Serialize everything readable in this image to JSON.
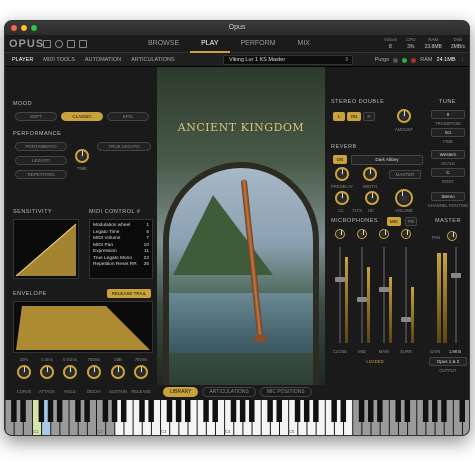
{
  "window": {
    "title": "Opus"
  },
  "app": {
    "logo": "OPUS"
  },
  "nav": {
    "tabs": [
      "BROWSE",
      "PLAY",
      "PERFORM",
      "MIX"
    ],
    "active": "PLAY"
  },
  "stats": [
    {
      "label": "Voices",
      "value": "8"
    },
    {
      "label": "CPU",
      "value": "3%"
    },
    {
      "label": "RAM",
      "value": "23.8MB"
    },
    {
      "label": "Disk",
      "value": "3MB/s"
    }
  ],
  "subnav": {
    "tabs": [
      "PLAYER",
      "MIDI TOOLS",
      "AUTOMATION",
      "ARTICULATIONS"
    ],
    "active": "PLAYER"
  },
  "preset": {
    "name": "Viking Lur 1 KS Master"
  },
  "purge": {
    "label": "Purge",
    "ram_label": "RAM",
    "ram_value": "24.1MB"
  },
  "mood": {
    "title": "MOOD",
    "buttons": [
      "SOFT",
      "CLASSIC",
      "EPIC"
    ],
    "active": "CLASSIC"
  },
  "performance": {
    "title": "PERFORMANCE",
    "buttons": [
      "PORTAMENTO",
      "TRUE LEGATO",
      "LEGATO",
      "REPETITION"
    ],
    "knob": "TIME"
  },
  "sensitivity": {
    "title": "SENSITIVITY"
  },
  "midi_control": {
    "title": "MIDI CONTROL #",
    "rows": [
      {
        "name": "Modulation wheel",
        "cc": "1"
      },
      {
        "name": "Legato Time",
        "cc": "5"
      },
      {
        "name": "MIDI Volume",
        "cc": "7"
      },
      {
        "name": "MIDI Pan",
        "cc": "10"
      },
      {
        "name": "Expression",
        "cc": "11"
      },
      {
        "name": "True Legato Mono",
        "cc": "22"
      },
      {
        "name": "Repetition Reset RR",
        "cc": "36"
      }
    ]
  },
  "envelope": {
    "title": "ENVELOPE",
    "release_btn": "RELEASE TRAIL",
    "values": [
      "20%",
      "0.3ms",
      "0.01ms",
      "750ms",
      "0dB",
      "750ms"
    ],
    "knobs": [
      "CURVE",
      "ATTACK",
      "HOLD",
      "DECAY",
      "SUSTAIN",
      "RELEASE"
    ]
  },
  "art": {
    "title": "ANCIENT KINGDOM"
  },
  "artbar": {
    "buttons": [
      "LIBRARY",
      "ARTICULATIONS",
      "MIC POSITIONS"
    ],
    "active": "LIBRARY"
  },
  "stereo": {
    "title": "STEREO DOUBLE",
    "buttons": [
      "L",
      "ON",
      "R"
    ],
    "knob": "AMOUNT"
  },
  "tune": {
    "title": "TUNE",
    "value": "0",
    "transpose": "TRANSPOSE",
    "transpose_val": "0ct",
    "fine": "FINE",
    "scale_val": "Western",
    "scale": "SCALE",
    "root_val": "C",
    "root": "ROOT"
  },
  "reverb": {
    "title": "REVERB",
    "on": "ON",
    "preset": "Dark Abbey",
    "master": "MASTER",
    "knobs": [
      "PREDELAY",
      "WIDTH",
      "LC",
      "TLTS",
      "HC",
      "VOLUME"
    ]
  },
  "channel": {
    "value": "Stereo",
    "label": "CHANNEL ROUTING"
  },
  "mics": {
    "title": "MICROPHONES",
    "btns": [
      "MIC",
      "PB"
    ],
    "channels": [
      "CLOSE",
      "MID",
      "MAIN",
      "SURR"
    ],
    "loaded": "LOADED"
  },
  "master": {
    "title": "MASTER",
    "pan": "PAN",
    "gain": "GAIN",
    "gain_val": "1.98 B",
    "output": "Opus 1 & 2",
    "output_label": "OUTPUT"
  },
  "keyboard": {
    "labels": [
      "C1",
      "C2",
      "C3",
      "C4",
      "C5"
    ]
  },
  "colors": {
    "accent": "#c9a23b",
    "bg": "#141414"
  }
}
